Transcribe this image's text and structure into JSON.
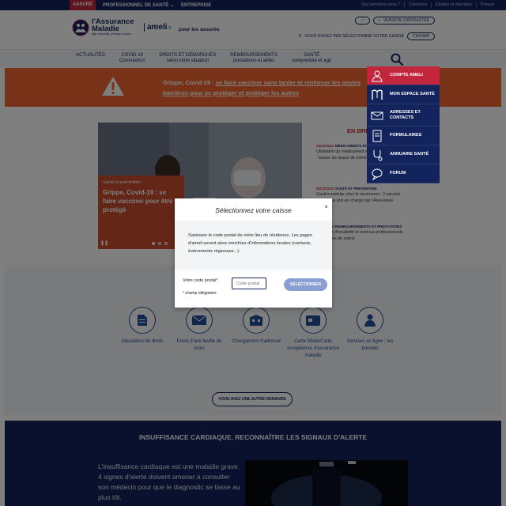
{
  "topbar": {
    "tabs": [
      "ASSURÉ",
      "PROFESSIONNEL DE SANTÉ",
      "ENTREPRISE"
    ],
    "links": [
      "Qui sommes-nous ?",
      "Carrières",
      "Études et données",
      "Presse"
    ]
  },
  "header": {
    "logo_line1": "l'Assurance",
    "logo_line2": "Maladie",
    "logo_tagline": "Agir ensemble, protéger chacun",
    "ameli": "ameli",
    "ameli_suffix": ".fr",
    "pour_les": "pour les assurés",
    "contrast_label": "VERSION CONTRASTÉE",
    "caisse_text": "VOUS N'AVEZ PAS SÉLECTIONNÉ VOTRE CAISSE",
    "choose_label": "CHOISIR"
  },
  "nav": [
    {
      "l1": "ACTUALITÉS",
      "l2": ""
    },
    {
      "l1": "COVID-19",
      "l2": "Coronavirus"
    },
    {
      "l1": "DROITS ET DÉMARCHES",
      "l2": "selon votre situation"
    },
    {
      "l1": "REMBOURSEMENTS",
      "l2": "prestations et aides"
    },
    {
      "l1": "SANTÉ",
      "l2": "comprendre et agir"
    }
  ],
  "alert": {
    "prefix": "Grippe, Covid-19 : ",
    "link": "se faire vacciner sans tarder et renforcer les gestes barrières pour se protéger et protéger les autres"
  },
  "dropdown": [
    {
      "label": "COMPTE AMELI",
      "icon": "user-icon"
    },
    {
      "label": "MON ESPACE SANTÉ",
      "icon": "mes-icon"
    },
    {
      "label": "ADRESSES ET CONTACTS",
      "icon": "mail-icon"
    },
    {
      "label": "FORMULAIRES",
      "icon": "form-icon"
    },
    {
      "label": "ANNUAIRE SANTÉ",
      "icon": "stethoscope-icon"
    },
    {
      "label": "FORUM",
      "icon": "chat-icon"
    }
  ],
  "hero": {
    "category": "Santé et prévention",
    "title_lines": [
      "Grippe, Covid-19 : se",
      "faire vacciner pour être",
      "protégé"
    ]
  },
  "news": {
    "title": "EN BREF",
    "items": [
      {
        "date": "05/12/2022",
        "cat": "MÉDICAMENTS ET SANTÉ",
        "text": "Utilisation du médicament et de ses génériques : baisse du risque de méningiome"
      },
      {
        "date": "02/12/2022",
        "cat": "SANTÉ ET PRÉVENTION",
        "text": "Gastro-entérite chez le nourrisson : 2 vaccins désormais pris en charge par l'Assurance Maladie"
      },
      {
        "date": "01/12/2022",
        "cat": "REMBOURSEMENTS ET PRESTATIONS",
        "text": "Pensions d'invalidité et revenus professionnels : les règles de cumul"
      }
    ]
  },
  "services": [
    {
      "label": "Attestation de droits",
      "icon": "document-icon"
    },
    {
      "label": "Envoi d'une feuille de soins",
      "icon": "envelope-icon"
    },
    {
      "label": "Changement d'adresse",
      "icon": "building-icon"
    },
    {
      "label": "Carte Vitale/Carte européenne d'assurance maladie",
      "icon": "card-icon"
    },
    {
      "label": "Services en ligne : les tutoriels",
      "icon": "person-icon"
    }
  ],
  "autre_demande": "VOUS AVEZ UNE AUTRE DEMANDE",
  "bottom": {
    "title": "INSUFFISANCE CARDIAQUE, RECONNAÎTRE LES SIGNAUX D'ALERTE",
    "text": "L'insuffisance cardiaque est une maladie grave. 4 signes d'alerte doivent amener à consulter son médecin pour que le diagnostic se fasse au plus tôt."
  },
  "modal": {
    "title": "Sélectionnez votre caisse",
    "close": "×",
    "body": "Saisissez le code postal de votre lieu de résidence. Les pages d'ameli seront alors enrichies d'informations locales (contacts, événements régionaux...).",
    "postal_label": "Votre code postal*",
    "postal_placeholder": "Code postal",
    "select_label": "SÉLECTIONNER",
    "required_note": "* champ obligatoire"
  },
  "colors": {
    "navy": "#13235c",
    "red": "#c1263c",
    "orange": "#f1652f",
    "blue": "#1f4c9a",
    "button": "#8b9fd3"
  }
}
